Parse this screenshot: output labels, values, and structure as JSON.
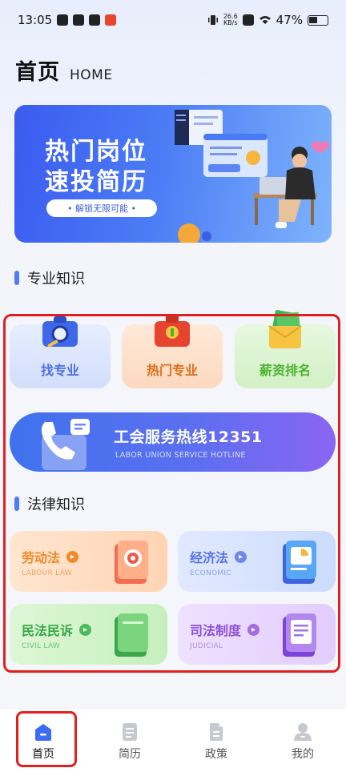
{
  "status_bar": {
    "time": "13:05",
    "net_speed_value": "26.6",
    "net_speed_unit": "KB/s",
    "battery": "47%"
  },
  "header": {
    "title": "首页",
    "subtitle": "HOME"
  },
  "banner": {
    "title_line1": "热门岗位",
    "title_line2": "速投简历",
    "pill": "• 解锁无限可能 •"
  },
  "sections": {
    "professional": "专业知识",
    "law": "法律知识"
  },
  "quick_tiles": [
    {
      "label": "找专业",
      "color": "#4d70e0"
    },
    {
      "label": "热门专业",
      "color": "#e06c18"
    },
    {
      "label": "薪资排名",
      "color": "#4bb42d"
    }
  ],
  "hotline": {
    "title": "工会服务热线12351",
    "subtitle": "LABOR UNION SERVICE HOTLINE"
  },
  "law_cards": [
    {
      "title": "劳动法",
      "subtitle": "LABOUR LAW",
      "color": "#f08a2a"
    },
    {
      "title": "经济法",
      "subtitle": "ECONOMIC",
      "color": "#5574e6"
    },
    {
      "title": "民法民诉",
      "subtitle": "CIVIL LAW",
      "color": "#37a94a"
    },
    {
      "title": "司法制度",
      "subtitle": "JUDICIAL",
      "color": "#8e4fd8"
    }
  ],
  "tabbar": [
    {
      "label": "首页",
      "icon": "home-icon",
      "active": true
    },
    {
      "label": "简历",
      "icon": "resume-icon",
      "active": false
    },
    {
      "label": "政策",
      "icon": "policy-icon",
      "active": false
    },
    {
      "label": "我的",
      "icon": "profile-icon",
      "active": false
    }
  ],
  "colors": {
    "accent": "#3a6cf4",
    "highlight": "#e0201f"
  }
}
